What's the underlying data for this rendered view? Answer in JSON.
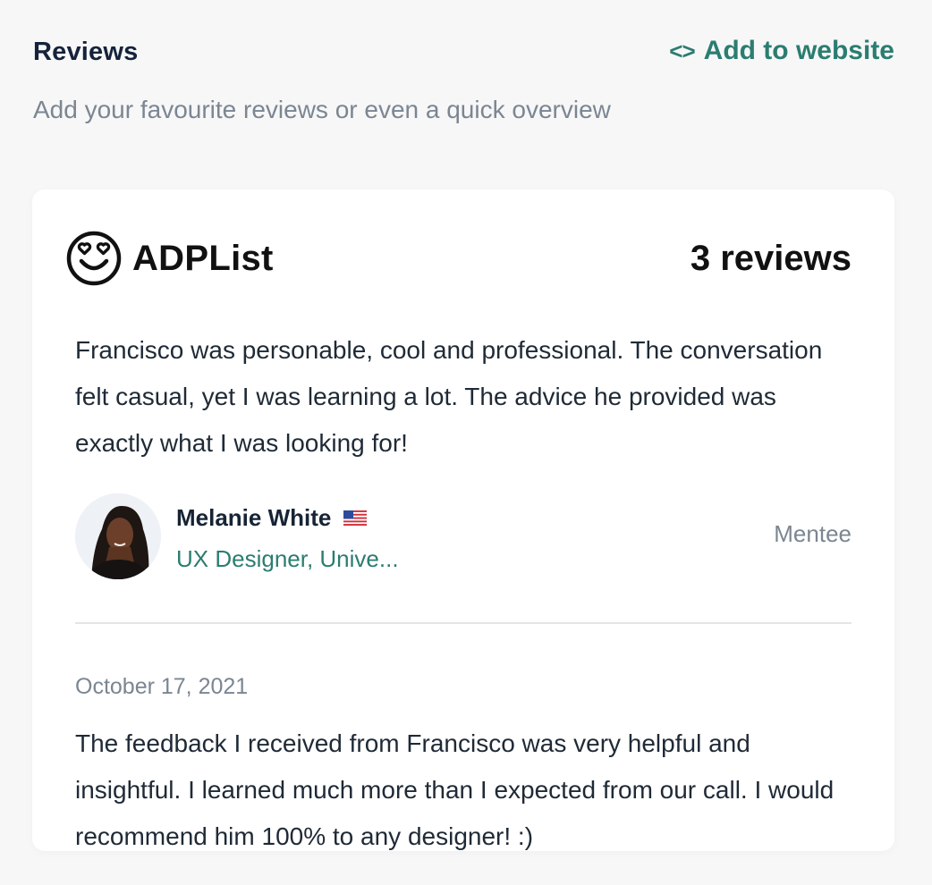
{
  "header": {
    "title": "Reviews",
    "add_link_icon": "<>",
    "add_link_label": "Add to website",
    "subtitle": "Add your favourite reviews or even a quick overview"
  },
  "card": {
    "brand_name": "ADPList",
    "brand_icon": "heart-eyes-smiley-icon",
    "review_count": "3 reviews",
    "reviews": [
      {
        "text": "Francisco was personable, cool and professional. The conversation felt casual, yet I was learning a lot. The advice he provided was exactly what I was looking for!",
        "reviewer_name": "Melanie White",
        "reviewer_flag": "us-flag-icon",
        "reviewer_role": "UX Designer, Unive...",
        "reviewer_type": "Mentee"
      },
      {
        "date": "October 17, 2021",
        "text": "The feedback I received from Francisco was very helpful and insightful. I learned much more than I expected from our call. I would recommend him 100% to any designer! :)"
      }
    ]
  },
  "colors": {
    "accent": "#2b7d70",
    "background": "#f7f7f8",
    "card": "#ffffff",
    "muted": "#7b8692"
  }
}
